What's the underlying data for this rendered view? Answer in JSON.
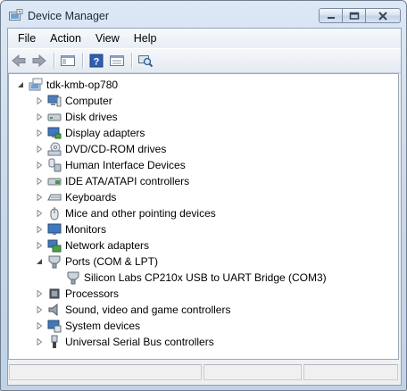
{
  "window": {
    "title": "Device Manager"
  },
  "menu": [
    "File",
    "Action",
    "View",
    "Help"
  ],
  "tree": {
    "root": "tdk-kmb-op780",
    "categories": [
      {
        "label": "Computer",
        "icon": "computer-icon"
      },
      {
        "label": "Disk drives",
        "icon": "disk-drive-icon"
      },
      {
        "label": "Display adapters",
        "icon": "display-adapter-icon"
      },
      {
        "label": "DVD/CD-ROM drives",
        "icon": "dvd-drive-icon"
      },
      {
        "label": "Human Interface Devices",
        "icon": "hid-icon"
      },
      {
        "label": "IDE ATA/ATAPI controllers",
        "icon": "ide-controller-icon"
      },
      {
        "label": "Keyboards",
        "icon": "keyboard-icon"
      },
      {
        "label": "Mice and other pointing devices",
        "icon": "mouse-icon"
      },
      {
        "label": "Monitors",
        "icon": "monitor-icon"
      },
      {
        "label": "Network adapters",
        "icon": "network-adapter-icon"
      },
      {
        "label": "Ports (COM & LPT)",
        "icon": "port-icon",
        "expanded": true,
        "children": [
          {
            "label": "Silicon Labs CP210x USB to UART Bridge (COM3)",
            "icon": "port-icon"
          }
        ]
      },
      {
        "label": "Processors",
        "icon": "processor-icon"
      },
      {
        "label": "Sound, video and game controllers",
        "icon": "sound-icon"
      },
      {
        "label": "System devices",
        "icon": "system-devices-icon"
      },
      {
        "label": "Universal Serial Bus controllers",
        "icon": "usb-icon"
      }
    ]
  },
  "colors": {
    "titlebar": "#c6d7ea",
    "close_hover": "#c75050",
    "tree_bg": "#ffffff"
  }
}
